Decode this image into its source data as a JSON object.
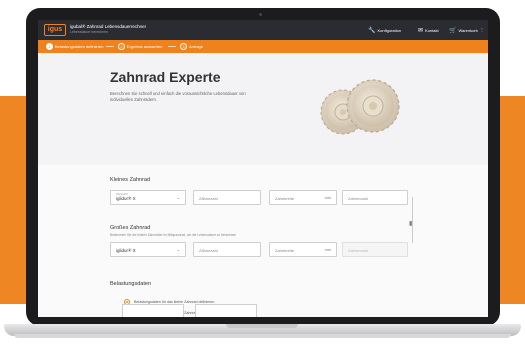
{
  "header": {
    "logo_text": "igus",
    "app_title": "igubal® Zahnrad Lebensdauerrechner",
    "app_subtitle": "Lebensdauer berechnen",
    "nav": [
      {
        "label": "Konfiguration",
        "icon": "wrench-icon"
      },
      {
        "label": "Kontakt",
        "icon": "mail-icon"
      },
      {
        "label": "Warenkorb",
        "icon": "cart-icon"
      }
    ]
  },
  "steps": [
    {
      "num": "1",
      "label": "Belastungsdaten definieren"
    },
    {
      "num": "2",
      "label": "Ergebnis auswerten"
    },
    {
      "num": "3",
      "label": "Anfrage"
    }
  ],
  "hero": {
    "title": "Zahnrad Experte",
    "description": "Berechnen Sie schnell und einfach die voraussichtliche Lebensdauer von individuellen Zahnrädern."
  },
  "small_gear": {
    "title": "Kleines Zahnrad",
    "material_label": "Werkstoff",
    "material_value": "iglidur® X",
    "teeth_placeholder": "Zähnezahl",
    "width_placeholder": "Zahnbreite",
    "width_unit": "mm",
    "module_placeholder": "Zahnmodul"
  },
  "large_gear": {
    "title": "Großes Zahnrad",
    "subtitle": "Bestimmen Sie die letzten Zahnräder im Mitspannrad, um die Lebensdauer zu berechnen",
    "material_value": "iglidur® X",
    "teeth_placeholder": "Zähnezahl",
    "width_placeholder": "Zahnbreite",
    "width_unit": "mm",
    "module_placeholder": "Zahnmodul"
  },
  "load": {
    "title": "Belastungsdaten",
    "option_small": "Belastungsdaten für das kleine Zahnrad definieren",
    "option_large": "Belastungsdaten für das große Zahnrad definieren"
  },
  "colors": {
    "accent": "#f0821e",
    "band": "#ee8623",
    "topbar": "#2b2c31"
  }
}
